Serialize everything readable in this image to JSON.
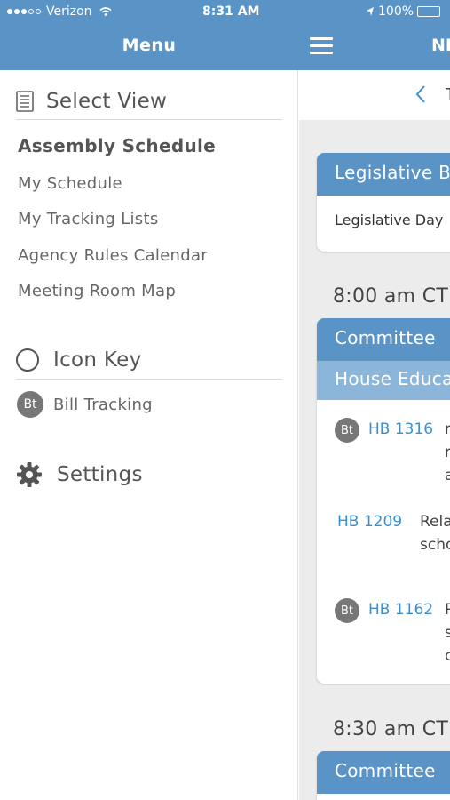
{
  "status_bar": {
    "carrier": "Verizon",
    "time": "8:31 AM",
    "battery": "100%"
  },
  "header": {
    "menu_title": "Menu",
    "main_title": "NE"
  },
  "menu": {
    "select_view_label": "Select View",
    "items": [
      {
        "label": "Assembly Schedule",
        "active": true
      },
      {
        "label": "My Schedule"
      },
      {
        "label": "My Tracking Lists"
      },
      {
        "label": "Agency Rules Calendar"
      },
      {
        "label": "Meeting Room Map"
      }
    ],
    "icon_key_label": "Icon Key",
    "key_items": [
      {
        "badge": "Bt",
        "label": "Bill Tracking"
      }
    ],
    "settings_label": "Settings"
  },
  "main": {
    "date_partial": "T",
    "card1": {
      "header": "Legislative B",
      "body": "Legislative Day"
    },
    "time1": "8:00 am CT",
    "card2": {
      "header": "Committee",
      "subheader": "House Educa",
      "bills": [
        {
          "badge": "Bt",
          "number": "HB 1316",
          "desc": [
            "r",
            "r",
            "a"
          ]
        },
        {
          "badge": "",
          "number": "HB 1209",
          "desc": [
            "Rela",
            "scho"
          ]
        },
        {
          "badge": "Bt",
          "number": "HB 1162",
          "desc": [
            "P",
            "s",
            "c"
          ]
        }
      ]
    },
    "time2": "8:30 am CT",
    "card3": {
      "header": "Committee"
    }
  },
  "colors": {
    "header_blue": "#5a93c6",
    "subheader_blue": "#8cb5da",
    "link_blue": "#3a8fcf",
    "badge_gray": "#777777"
  }
}
